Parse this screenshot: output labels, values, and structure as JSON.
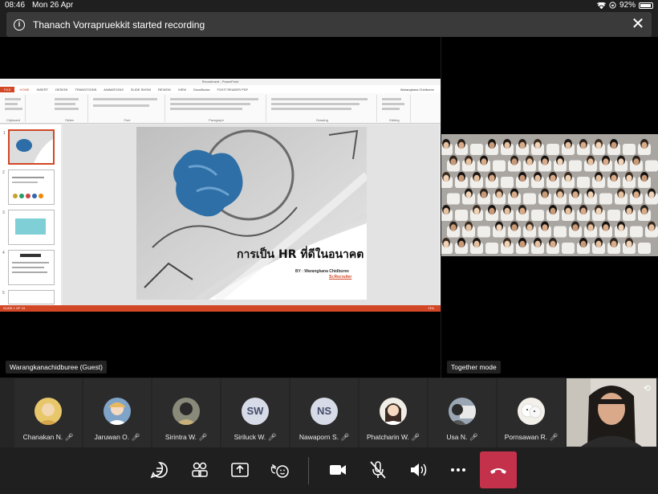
{
  "status_bar": {
    "time": "08:46",
    "date": "Mon 26 Apr",
    "battery": "92%"
  },
  "banner": {
    "text": "Thanach Vorrapruekkit started recording"
  },
  "share": {
    "presenter_name": "Warangkanachidburee (Guest)",
    "app_title": "Recruitment - PowerPoint",
    "tabs": [
      "FILE",
      "HOME",
      "INSERT",
      "DESIGN",
      "TRANSITIONS",
      "ANIMATIONS",
      "SLIDE SHOW",
      "REVIEW",
      "VIEW",
      "DocuBooks",
      "FOXIT READER PDF"
    ],
    "account": "Warangkana Chidburee",
    "ribbon_groups": [
      "Clipboard",
      "Slides",
      "Font",
      "Paragraph",
      "Drawing",
      "Editing"
    ],
    "slide": {
      "title": "การเป็น HR ที่ดีในอนาคต",
      "by": "BY : Warangkana Chidburee",
      "role": "Sr.Recruiter"
    },
    "thumb_labels": [
      "1",
      "2",
      "3",
      "4",
      "5"
    ],
    "status_left": "SLIDE 1 OF 15",
    "status_right": "74%"
  },
  "together": {
    "label": "Together mode"
  },
  "participants": [
    {
      "name": "Chanakan N.",
      "avatar": "photo",
      "color": "#e8c76a"
    },
    {
      "name": "Jaruwan O.",
      "avatar": "photo",
      "color": "#7fa4c8"
    },
    {
      "name": "Sirintra W.",
      "avatar": "photo",
      "color": "#4a4a3a"
    },
    {
      "name": "Siriluck W.",
      "avatar": "initials",
      "initials": "SW"
    },
    {
      "name": "Nawaporn S.",
      "avatar": "initials",
      "initials": "NS"
    },
    {
      "name": "Phatcharin W.",
      "avatar": "photo",
      "color": "#f0ece6"
    },
    {
      "name": "Usa N.",
      "avatar": "photo",
      "color": "#9aa6b4"
    },
    {
      "name": "Pornsawan R.",
      "avatar": "photo",
      "color": "#f3efe9"
    }
  ],
  "controls": [
    "chat-icon",
    "people-icon",
    "share-screen-icon",
    "reactions-icon",
    "camera-icon",
    "mic-muted-icon",
    "speaker-icon",
    "more-icon",
    "hangup-icon"
  ],
  "colors": {
    "hangup": "#c4314b",
    "ppt_accent": "#d24726",
    "banner": "#3a3a3a"
  }
}
